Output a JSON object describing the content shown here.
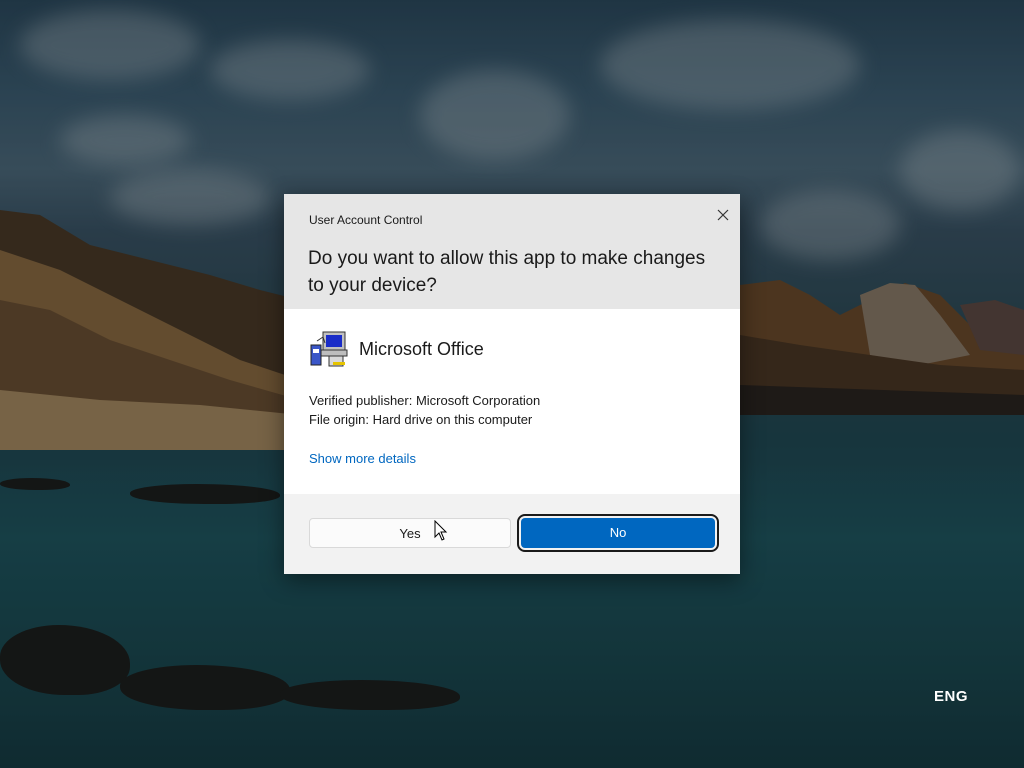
{
  "dialog": {
    "title": "User Account Control",
    "question": "Do you want to allow this app to make changes to your device?",
    "close_icon": "close-icon",
    "app_icon": "installer-icon",
    "app_name": "Microsoft Office",
    "publisher_line": "Verified publisher: Microsoft Corporation",
    "origin_line": "File origin: Hard drive on this computer",
    "more_details_link": "Show more details",
    "yes_label": "Yes",
    "no_label": "No",
    "accent_color": "#0067c0"
  },
  "taskbar": {
    "language": "ENG"
  }
}
